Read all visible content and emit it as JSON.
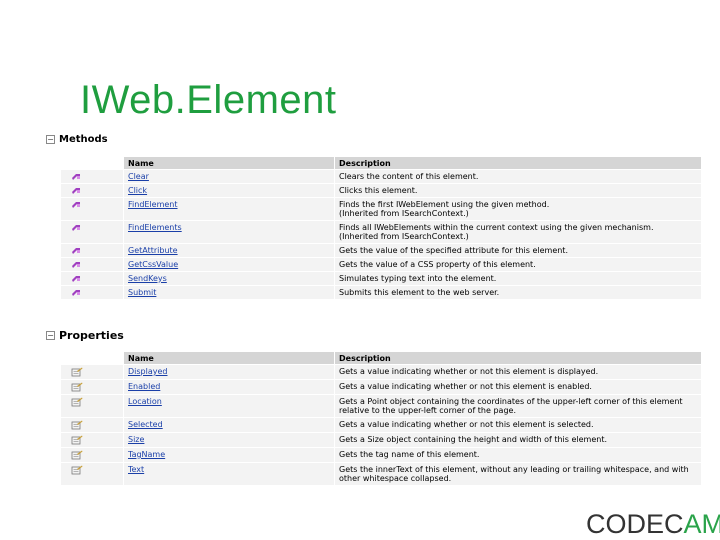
{
  "title": "IWeb.Element",
  "methods": {
    "heading": "Methods",
    "columns": [
      "Name",
      "Description"
    ],
    "rows": [
      {
        "name": "Clear",
        "desc": [
          "Clears the content of this element."
        ]
      },
      {
        "name": "Click",
        "desc": [
          "Clicks this element."
        ]
      },
      {
        "name": "FindElement",
        "desc": [
          "Finds the first IWebElement using the given method.",
          "(Inherited from ISearchContext.)"
        ]
      },
      {
        "name": "FindElements",
        "desc": [
          "Finds all IWebElements within the current context using the given mechanism.",
          "(Inherited from ISearchContext.)"
        ]
      },
      {
        "name": "GetAttribute",
        "desc": [
          "Gets the value of the specified attribute for this element."
        ]
      },
      {
        "name": "GetCssValue",
        "desc": [
          "Gets the value of a CSS property of this element."
        ]
      },
      {
        "name": "SendKeys",
        "desc": [
          "Simulates typing text into the element."
        ]
      },
      {
        "name": "Submit",
        "desc": [
          "Submits this element to the web server."
        ]
      }
    ]
  },
  "properties": {
    "heading": "Properties",
    "columns": [
      "Name",
      "Description"
    ],
    "rows": [
      {
        "name": "Displayed",
        "desc": [
          "Gets a value indicating whether or not this element is displayed."
        ]
      },
      {
        "name": "Enabled",
        "desc": [
          "Gets a value indicating whether or not this element is enabled."
        ]
      },
      {
        "name": "Location",
        "desc": [
          "Gets a Point object containing the coordinates of the upper-left corner of this element",
          "relative to the upper-left corner of the page."
        ]
      },
      {
        "name": "Selected",
        "desc": [
          "Gets a value indicating whether or not this element is selected."
        ]
      },
      {
        "name": "Size",
        "desc": [
          "Gets a Size object containing the height and width of this element."
        ]
      },
      {
        "name": "TagName",
        "desc": [
          "Gets the tag name of this element."
        ]
      },
      {
        "name": "Text",
        "desc": [
          "Gets the innerText of this element, without any leading or trailing whitespace, and with",
          "other whitespace collapsed."
        ]
      }
    ]
  },
  "logo": {
    "part1": "CODEC",
    "part2": "AMP"
  },
  "colors": {
    "title": "#1f9e3f",
    "link": "#1a3fa8",
    "header_bg": "#d5d5d5",
    "row_bg": "#f3f3f3"
  }
}
